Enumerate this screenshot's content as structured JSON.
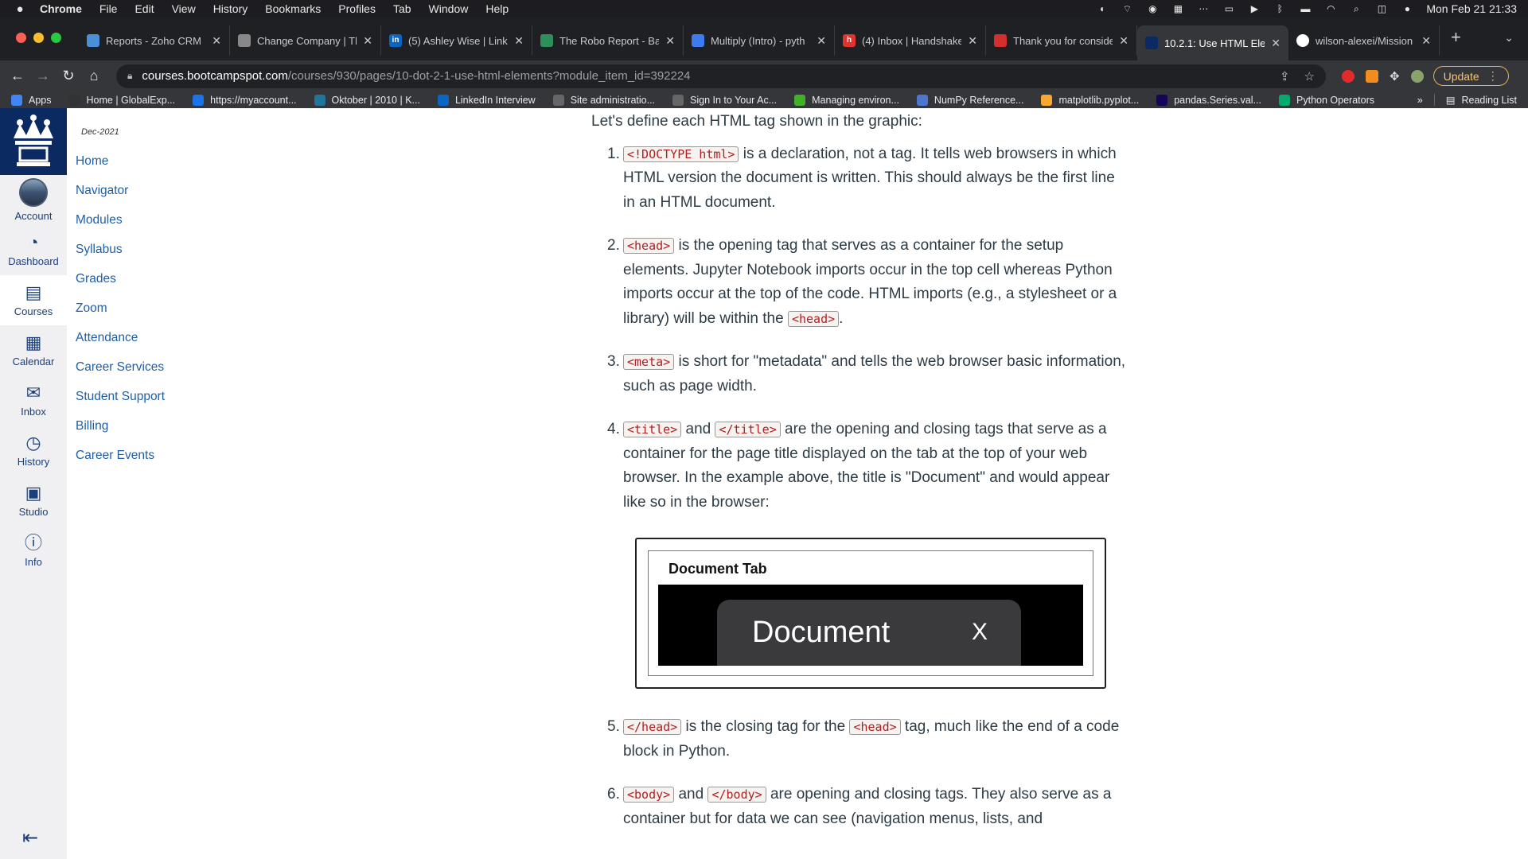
{
  "menubar": {
    "apple": "",
    "items": [
      "Chrome",
      "File",
      "Edit",
      "View",
      "History",
      "Bookmarks",
      "Profiles",
      "Tab",
      "Window",
      "Help"
    ],
    "datetime": "Mon Feb 21  21:33"
  },
  "tabs": [
    {
      "title": "Reports - Zoho CRM",
      "color": "#4a90d9",
      "glyph": ""
    },
    {
      "title": "Change Company | Th",
      "color": "#888888",
      "glyph": ""
    },
    {
      "title": "(5) Ashley Wise | Link",
      "color": "#0a66c2",
      "glyph": "in"
    },
    {
      "title": "The Robo Report - Ba",
      "color": "#2f8f5b",
      "glyph": ""
    },
    {
      "title": "Multiply (Intro) - pyth",
      "color": "#3c7cf0",
      "glyph": ""
    },
    {
      "title": "(4) Inbox | Handshake",
      "color": "#e0322e",
      "glyph": "h"
    },
    {
      "title": "Thank you for conside",
      "color": "#d32f2f",
      "glyph": ""
    },
    {
      "title": "10.2.1: Use HTML Ele",
      "color": "#0b2a61",
      "glyph": ""
    },
    {
      "title": "wilson-alexei/Mission",
      "color": "#ffffff",
      "glyph": ""
    }
  ],
  "toolbar": {
    "url_host": "courses.bootcampspot.com",
    "url_path": "/courses/930/pages/10-dot-2-1-use-html-elements?module_item_id=392224",
    "update_label": "Update"
  },
  "bookmarks": [
    {
      "label": "Apps",
      "color": "#4285f4"
    },
    {
      "label": "Home | GlobalExp...",
      "color": "#333333"
    },
    {
      "label": "https://myaccount...",
      "color": "#1a73e8"
    },
    {
      "label": "Oktober | 2010 | K...",
      "color": "#21759b"
    },
    {
      "label": "LinkedIn Interview",
      "color": "#0a66c2"
    },
    {
      "label": "Site administratio...",
      "color": "#666666"
    },
    {
      "label": "Sign In to Your Ac...",
      "color": "#666666"
    },
    {
      "label": "Managing environ...",
      "color": "#43b02a"
    },
    {
      "label": "NumPy Reference...",
      "color": "#4d77cf"
    },
    {
      "label": "matplotlib.pyplot...",
      "color": "#f7a830"
    },
    {
      "label": "pandas.Series.val...",
      "color": "#150458"
    },
    {
      "label": "Python Operators",
      "color": "#04aa6d"
    }
  ],
  "bookmarks_more": "»",
  "reading_list": "Reading List",
  "globalnav": [
    {
      "label": "Account",
      "icon": "avatar"
    },
    {
      "label": "Dashboard",
      "icon": "◔"
    },
    {
      "label": "Courses",
      "icon": "▤"
    },
    {
      "label": "Calendar",
      "icon": "▦"
    },
    {
      "label": "Inbox",
      "icon": "✉"
    },
    {
      "label": "History",
      "icon": "◷"
    },
    {
      "label": "Studio",
      "icon": "▣"
    },
    {
      "label": "Info",
      "icon": "ⓘ"
    }
  ],
  "course": {
    "term": "Dec-2021",
    "nav": [
      "Home",
      "Navigator",
      "Modules",
      "Syllabus",
      "Grades",
      "Zoom",
      "Attendance",
      "Career Services",
      "Student Support",
      "Billing",
      "Career Events"
    ]
  },
  "content": {
    "intro": "Let's define each HTML tag shown in the graphic:",
    "items": [
      {
        "n": "1.",
        "parts": [
          {
            "code": "<!DOCTYPE html>"
          },
          {
            "text": " is a declaration, not a tag. It tells web browsers in which HTML version the document is written. This should always be the first line in an HTML document."
          }
        ]
      },
      {
        "n": "2.",
        "parts": [
          {
            "code": "<head>"
          },
          {
            "text": " is the opening tag that serves as a container for the setup elements. Jupyter Notebook imports occur in the top cell whereas Python imports occur at the top of the code. HTML imports (e.g., a stylesheet or a library) will be within the "
          },
          {
            "code": "<head>"
          },
          {
            "text": "."
          }
        ]
      },
      {
        "n": "3.",
        "parts": [
          {
            "code": "<meta>"
          },
          {
            "text": " is short for \"metadata\" and tells the web browser basic information, such as page width."
          }
        ]
      },
      {
        "n": "4.",
        "parts": [
          {
            "code": "<title>"
          },
          {
            "text": " and "
          },
          {
            "code": "</title>"
          },
          {
            "text": " are the opening and closing tags that serve as a container for the page title displayed on the tab at the top of your web browser. In the example above, the title is \"Document\" and would appear like so in the browser:"
          }
        ]
      }
    ],
    "figure": {
      "heading": "Document Tab",
      "tab_label": "Document",
      "close_glyph": "X"
    },
    "items2": [
      {
        "n": "5.",
        "parts": [
          {
            "code": "</head>"
          },
          {
            "text": " is the closing tag for the "
          },
          {
            "code": "<head>"
          },
          {
            "text": " tag, much like the end of a code block in Python."
          }
        ]
      },
      {
        "n": "6.",
        "parts": [
          {
            "code": "<body>"
          },
          {
            "text": " and "
          },
          {
            "code": "</body>"
          },
          {
            "text": " are opening and closing tags. They also serve as a container but for data we can see (navigation menus, lists, and"
          }
        ]
      }
    ]
  }
}
